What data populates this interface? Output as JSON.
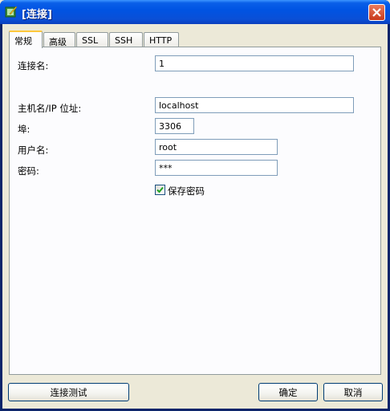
{
  "window": {
    "title": "[连接]"
  },
  "tabs": [
    {
      "label": "常规"
    },
    {
      "label": "高级"
    },
    {
      "label": "SSL"
    },
    {
      "label": "SSH"
    },
    {
      "label": "HTTP"
    }
  ],
  "form": {
    "connection_name": {
      "label": "连接名:",
      "value": "1"
    },
    "host": {
      "label": "主机名/IP 位址:",
      "value": "localhost"
    },
    "port": {
      "label": "埠:",
      "value": "3306"
    },
    "username": {
      "label": "用户名:",
      "value": "root"
    },
    "password": {
      "label": "密码:",
      "value": "***"
    },
    "save_password": {
      "label": "保存密码",
      "checked": true
    }
  },
  "buttons": {
    "test": "连接测试",
    "ok": "确定",
    "cancel": "取消"
  }
}
